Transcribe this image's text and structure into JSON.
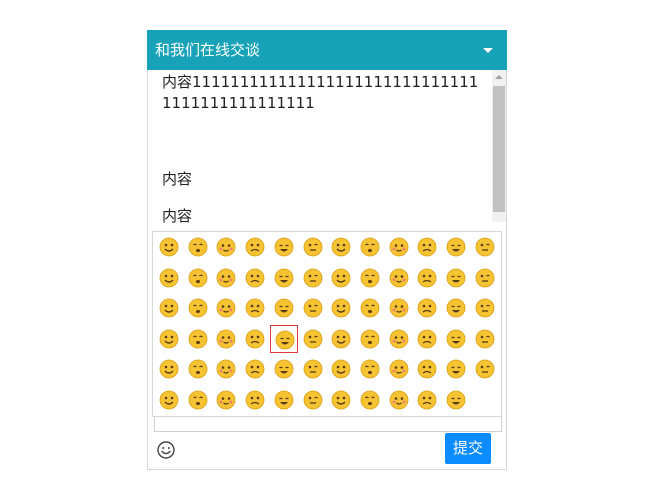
{
  "header": {
    "title": "和我们在线交谈"
  },
  "messages": [
    {
      "text": "内容1111111111111111111111111111111111111111111111"
    },
    {
      "text": "内容"
    },
    {
      "text": "内容"
    },
    {
      "text": "内容"
    }
  ],
  "emoji_panel": {
    "columns": 12,
    "selected_index": 40,
    "emojis": [
      "kiss",
      "confused",
      "grin-teeth",
      "glasses",
      "rub-eyes",
      "sad",
      "tongue",
      "drool",
      "shocked",
      "frightened",
      "bye",
      "clap",
      "hammer",
      "doge",
      "dizzy-fish",
      "thumbs-up-hand",
      "ok-hand",
      "blush",
      "laugh",
      "pout",
      "scream",
      "smirk",
      "giggle",
      "heart-eyes",
      "angry-red",
      "tongue-out",
      "smile",
      "pray",
      "mask",
      "sunglasses",
      "skull",
      "tired",
      "rofl",
      "eyeroll",
      "sob",
      "cat",
      "question",
      "rage",
      "ok-fingers",
      "money",
      "shush",
      "fist",
      "grumpy",
      "sweat",
      "sleepy",
      "black-ball",
      "wry",
      "shy",
      "hug",
      "heart-kiss",
      "think",
      "yawn",
      "snicker",
      "sweat-drop",
      "angel",
      "rolling-eyes",
      "handshake",
      "wronged",
      "pity",
      "tears-joy",
      "big-grin",
      "hmm",
      "victory",
      "squint",
      "wink",
      "spiral",
      "ok-thumb",
      "cry-angry",
      "facepalm",
      "tsk",
      "hands-together"
    ],
    "colors": {
      "face": "#f6c433",
      "face_edge": "#d99b10",
      "feature": "#5a3a10",
      "blush": "#f08070",
      "selected_border": "#e0383c"
    }
  },
  "editor": {
    "submit_label": "提交"
  },
  "theme": {
    "header_bg": "#17a2b8",
    "submit_bg": "#0a8cff"
  }
}
